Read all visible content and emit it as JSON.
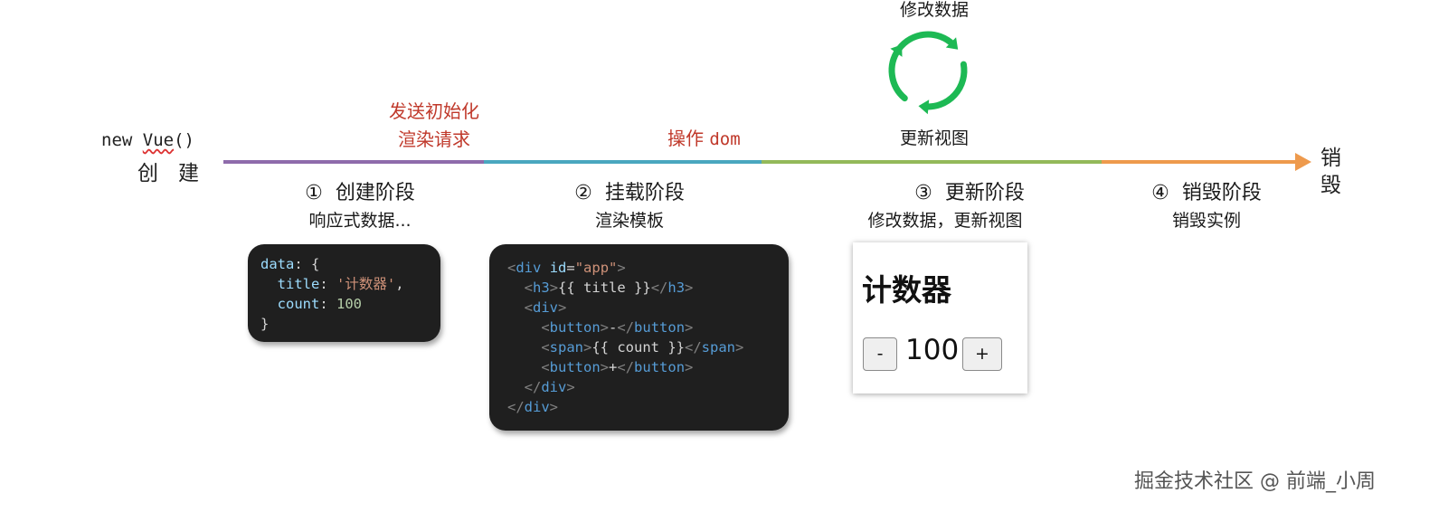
{
  "start": {
    "code_prefix": "new ",
    "code_vue": "Vue",
    "code_suffix": "()",
    "label": "创建"
  },
  "annotations": {
    "init_request_line1": "发送初始化",
    "init_request_line2": "渲染请求",
    "dom_op_text": "操作",
    "dom_op_code": "dom"
  },
  "cycle": {
    "top_label": "修改数据",
    "bottom_label": "更新视图",
    "color": "#1db954"
  },
  "timeline": {
    "colors": [
      "#8e6bab",
      "#4aa7bf",
      "#93b95a",
      "#ee9a4d"
    ],
    "end_label_1": "销",
    "end_label_2": "毁"
  },
  "stages": [
    {
      "number": "①",
      "title": "创建阶段",
      "subtitle": "响应式数据..."
    },
    {
      "number": "②",
      "title": "挂载阶段",
      "subtitle": "渲染模板"
    },
    {
      "number": "③",
      "title": "更新阶段",
      "subtitle": "修改数据，更新视图"
    },
    {
      "number": "④",
      "title": "销毁阶段",
      "subtitle": "销毁实例"
    }
  ],
  "code_data": {
    "kw_data": "data",
    "kw_title": "title",
    "title_value": "'计数器'",
    "kw_count": "count",
    "count_value": "100"
  },
  "code_template": {
    "div_attr": "id",
    "div_attr_value": "\"app\"",
    "title_expr": "{{ title }}",
    "minus_text": "-",
    "count_expr": "{{ count }}",
    "plus_text": "+"
  },
  "preview": {
    "title": "计数器",
    "minus": "-",
    "count": "100",
    "plus": "+"
  },
  "watermark": "掘金技术社区 @ 前端_小周"
}
